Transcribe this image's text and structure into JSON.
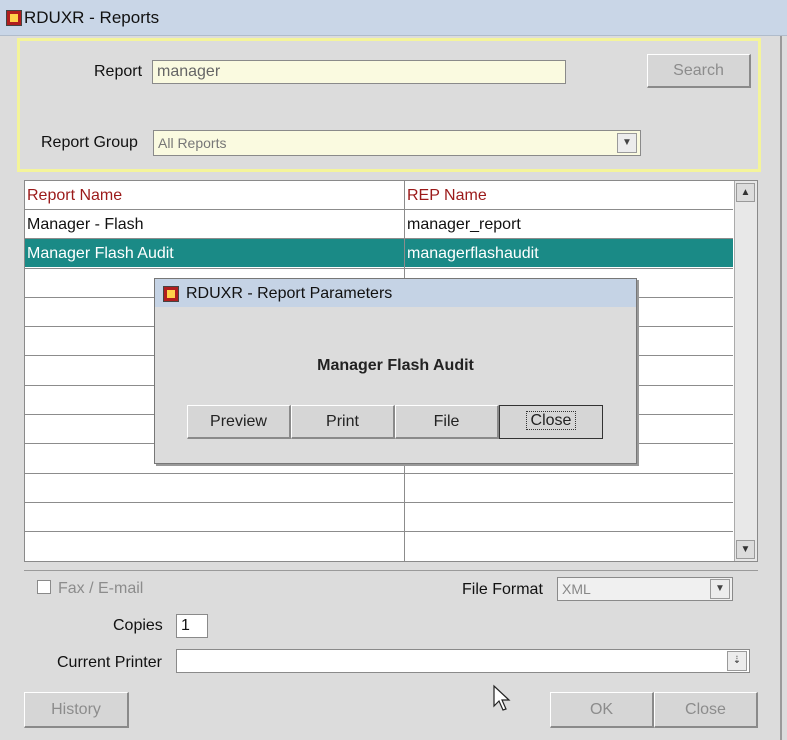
{
  "window": {
    "title": "RDUXR - Reports"
  },
  "search": {
    "report_label": "Report",
    "report_value": "manager",
    "search_button": "Search",
    "group_label": "Report Group",
    "group_value": "All Reports"
  },
  "grid": {
    "columns": [
      "Report Name",
      "REP Name"
    ],
    "rows": [
      {
        "name": "Manager - Flash",
        "rep": "manager_report",
        "selected": false
      },
      {
        "name": "Manager Flash Audit",
        "rep": "managerflashaudit",
        "selected": true
      }
    ]
  },
  "dialog": {
    "title": "RDUXR - Report Parameters",
    "message": "Manager Flash Audit",
    "buttons": [
      "Preview",
      "Print",
      "File",
      "Close"
    ]
  },
  "options": {
    "fax_label": "Fax / E-mail",
    "file_format_label": "File Format",
    "file_format_value": "XML",
    "copies_label": "Copies",
    "copies_value": "1",
    "printer_label": "Current Printer",
    "printer_value": ""
  },
  "footer": {
    "history_button": "History",
    "ok_button": "OK",
    "close_button": "Close"
  },
  "colors": {
    "selection": "#1a8a86",
    "search_panel_border": "#f4f49a",
    "header_text": "#9b1a1a"
  }
}
